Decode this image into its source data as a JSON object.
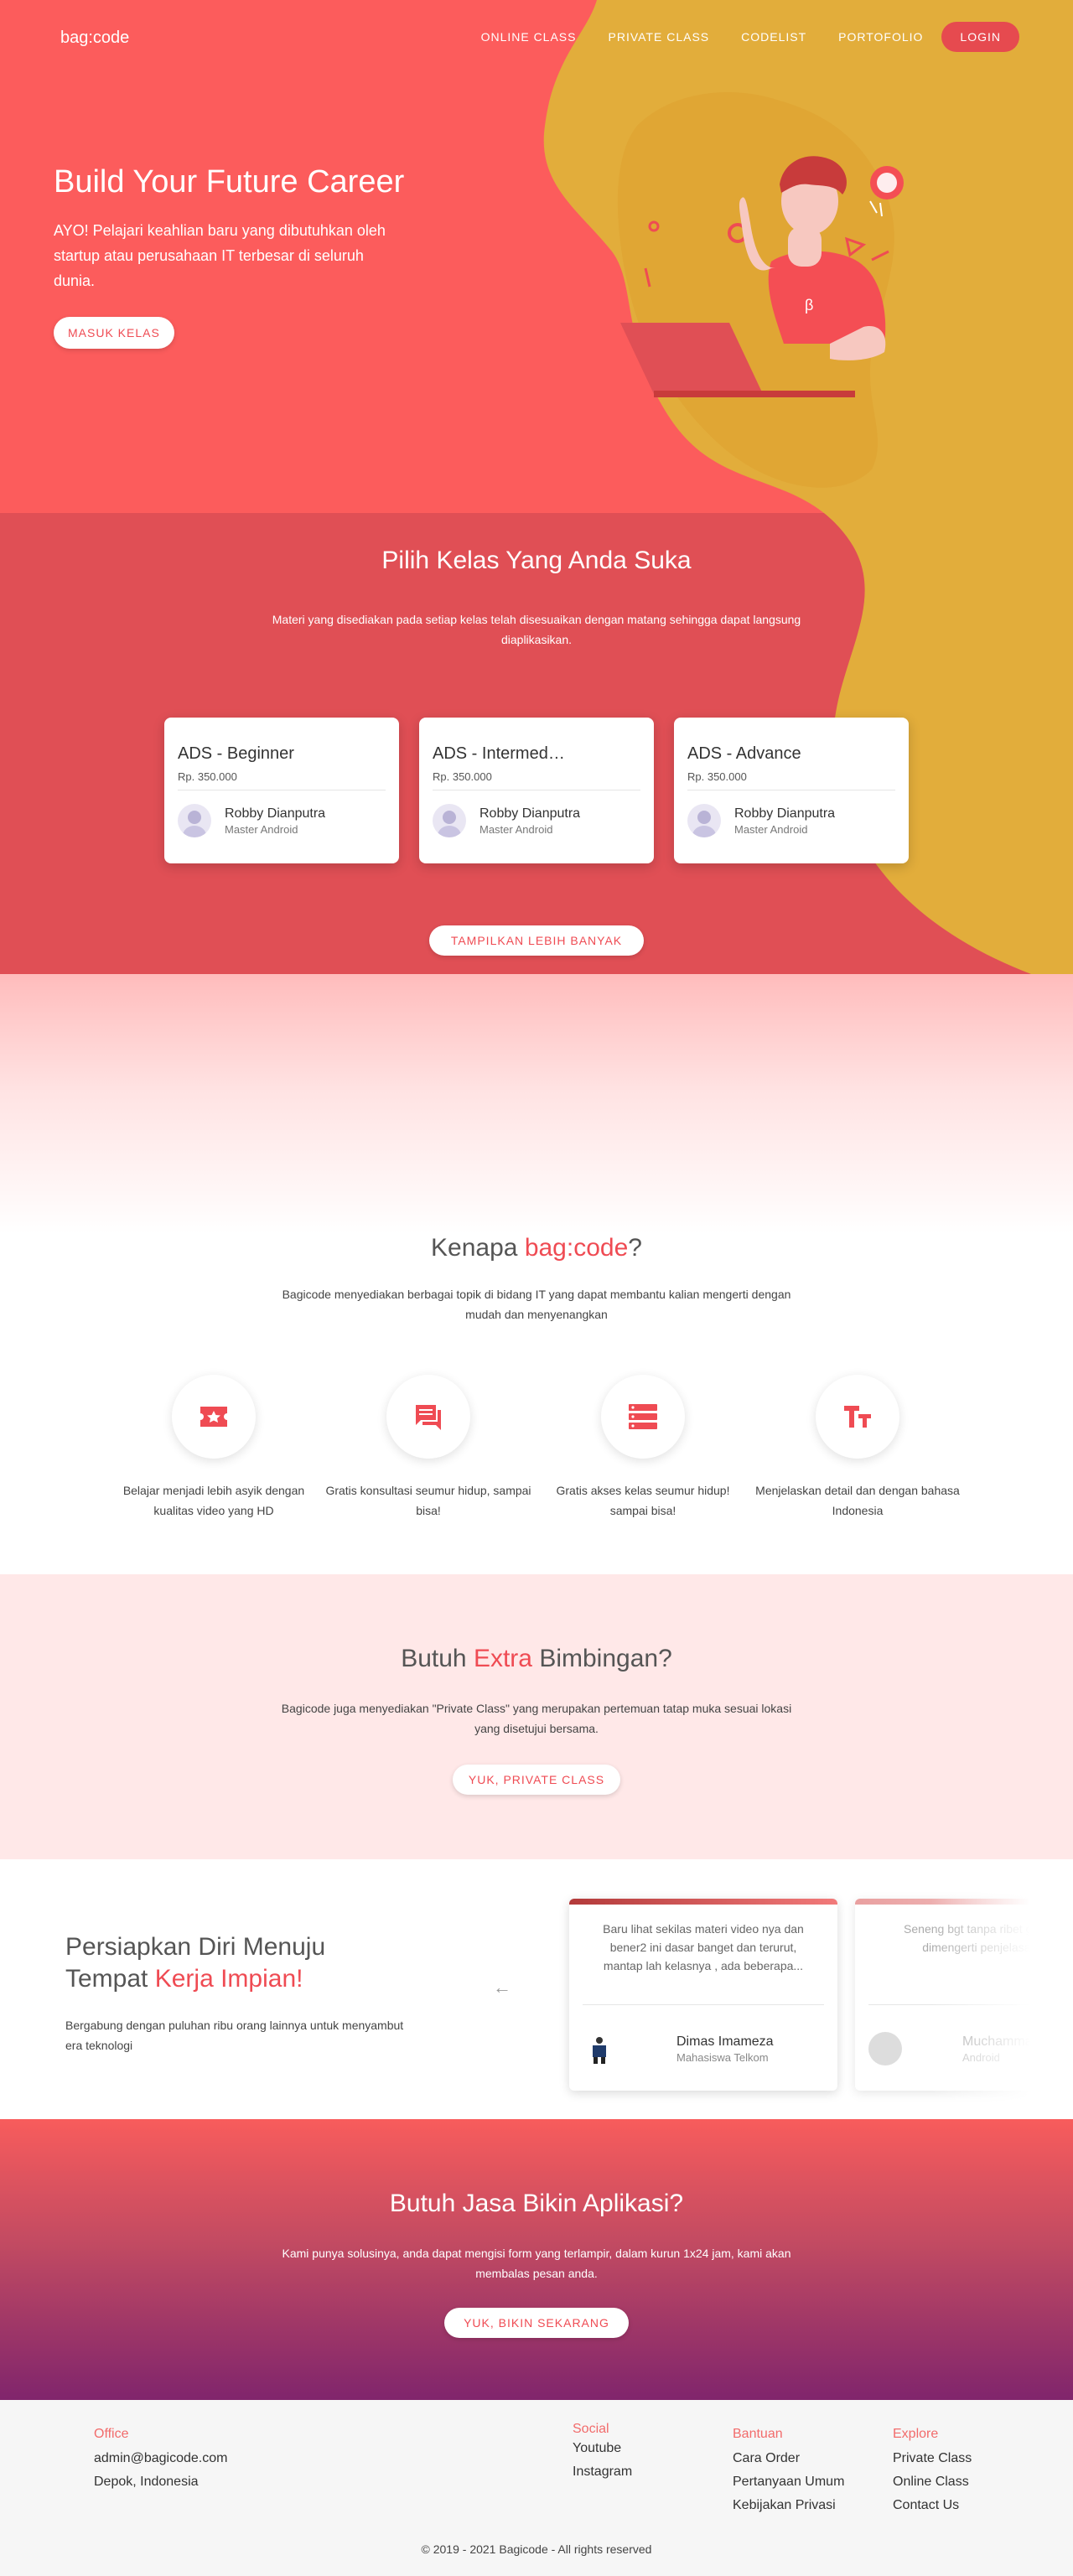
{
  "colors": {
    "primary": "#fc5c5c",
    "accent": "#ef4b53",
    "blob": "#e2ad3b",
    "footer_head": "#f26b6b",
    "service_end": "#80256c"
  },
  "nav": {
    "brand": "bag:code",
    "links": [
      "ONLINE CLASS",
      "PRIVATE CLASS",
      "CODELIST",
      "PORTOFOLIO"
    ],
    "login": "LOGIN"
  },
  "hero": {
    "title": "Build Your Future Career",
    "desc": "AYO! Pelajari keahlian baru yang dibutuhkan oleh startup atau perusahaan IT terbesar di seluruh dunia.",
    "button": "MASUK KELAS"
  },
  "classes": {
    "title": "Pilih Kelas Yang Anda Suka",
    "desc": "Materi yang disediakan pada setiap kelas telah disesuaikan dengan matang sehingga dapat langsung diaplikasikan.",
    "cards": [
      {
        "name": "ADS - Beginner",
        "price": "Rp. 350.000",
        "mentor": "Robby Dianputra",
        "role": "Master Android"
      },
      {
        "name": "ADS - Intermediate",
        "price": "Rp. 350.000",
        "mentor": "Robby Dianputra",
        "role": "Master Android"
      },
      {
        "name": "ADS - Advance",
        "price": "Rp. 350.000",
        "mentor": "Robby Dianputra",
        "role": "Master Android"
      }
    ],
    "more": "TAMPILKAN LEBIH BANYAK"
  },
  "why": {
    "title_pre": "Kenapa ",
    "title_accent": "bag:code",
    "title_post": "?",
    "desc": "Bagicode menyediakan berbagai topik di bidang IT yang dapat membantu kalian mengerti dengan mudah dan menyenangkan",
    "features": [
      {
        "icon": "video-ticket-icon",
        "text": "Belajar menjadi lebih asyik dengan kualitas video yang HD"
      },
      {
        "icon": "chat-icon",
        "text": "Gratis konsultasi seumur hidup, sampai bisa!"
      },
      {
        "icon": "list-icon",
        "text": "Gratis akses kelas seumur hidup! sampai bisa!"
      },
      {
        "icon": "text-size-icon",
        "text": "Menjelaskan detail dan dengan bahasa Indonesia"
      }
    ]
  },
  "extra": {
    "title_pre": "Butuh ",
    "title_accent": "Extra",
    "title_post": " Bimbingan?",
    "desc": "Bagicode juga menyediakan \"Private Class\" yang merupakan pertemuan tatap muka sesuai lokasi yang disetujui bersama.",
    "button": "YUK, PRIVATE CLASS"
  },
  "testimonial": {
    "title_line1": "Persiapkan Diri Menuju",
    "title_pre": "Tempat ",
    "title_accent": "Kerja Impian!",
    "desc": "Bergabung dengan puluhan ribu orang lainnya untuk menyambut era teknologi",
    "arrow": "←",
    "items": [
      {
        "quote": "Baru lihat sekilas materi video nya dan bener2 ini dasar banget dan terurut, mantap lah kelasnya , ada beberapa...",
        "name": "Dimas Imameza",
        "role": "Mahasiswa Telkom"
      },
      {
        "quote": "Seneng bgt tanpa ribet gampang dimengerti penjelasannya",
        "name": "Muchammad",
        "role": "Android"
      }
    ]
  },
  "service": {
    "title": "Butuh Jasa Bikin Aplikasi?",
    "desc": "Kami punya solusinya, anda dapat mengisi form yang terlampir, dalam kurun 1x24 jam, kami akan membalas pesan anda.",
    "button": "YUK, BIKIN SEKARANG"
  },
  "footer": {
    "office": {
      "head": "Office",
      "items": [
        "admin@bagicode.com",
        "Depok, Indonesia"
      ]
    },
    "social": {
      "head": "Social",
      "items": [
        "Youtube",
        "Instagram"
      ]
    },
    "bantuan": {
      "head": "Bantuan",
      "items": [
        "Cara Order",
        "Pertanyaan Umum",
        "Kebijakan Privasi"
      ]
    },
    "explore": {
      "head": "Explore",
      "items": [
        "Private Class",
        "Online Class",
        "Contact Us"
      ]
    },
    "copyright": "© 2019 - 2021 Bagicode - All rights reserved"
  }
}
